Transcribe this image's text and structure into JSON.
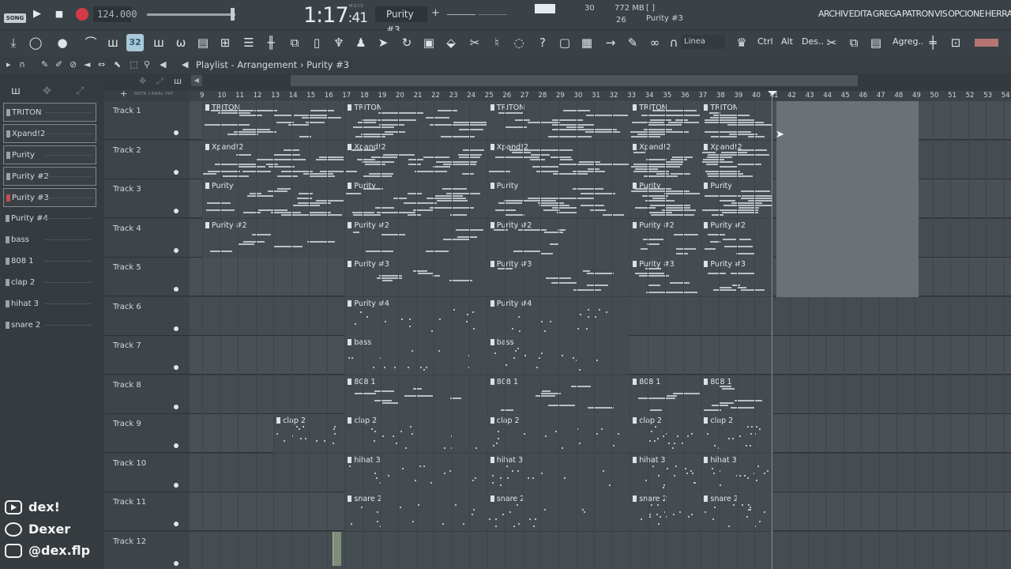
{
  "transport": {
    "song_label": "SONG",
    "tempo": "124.000",
    "time_main": "1:17",
    "time_small": ":41",
    "time_unit": "M:S:CS",
    "pattern": "Purity #3",
    "pattern_plus": "+"
  },
  "stats": {
    "cpu": "30",
    "memory": "772 MB",
    "bracket": "[    ]",
    "polyphony": "26",
    "hint": "Purity #3"
  },
  "menu": [
    "ARCHIV",
    "EDITA",
    "GREGA",
    "PATRON",
    "VIS",
    "OPCIONE",
    "HERRAMIEN"
  ],
  "toolbar": {
    "snap": "Linea",
    "ctrl": "Ctrl",
    "alt": "Alt",
    "des": "Des..",
    "agreg": "Agreg..",
    "active_label": "32"
  },
  "breadcrumb": {
    "view": "Playlist - Arrangement",
    "sep": "›",
    "pattern": "Purity #3"
  },
  "mini_header": "NOTA  CANAL  PAT",
  "patterns": [
    {
      "name": "TRITON",
      "boxed": true,
      "selected": false
    },
    {
      "name": "Xpand!2",
      "boxed": true,
      "selected": false
    },
    {
      "name": "Purity",
      "boxed": true,
      "selected": false
    },
    {
      "name": "Purity #2",
      "boxed": true,
      "selected": false
    },
    {
      "name": "Purity #3",
      "boxed": true,
      "selected": true
    },
    {
      "name": "Purity #4",
      "boxed": false,
      "selected": false
    },
    {
      "name": "bass",
      "boxed": false,
      "selected": false
    },
    {
      "name": "808 1",
      "boxed": false,
      "selected": false
    },
    {
      "name": "clap 2",
      "boxed": false,
      "selected": false
    },
    {
      "name": "hihat 3",
      "boxed": false,
      "selected": false
    },
    {
      "name": "snare 2",
      "boxed": false,
      "selected": false
    }
  ],
  "ruler": [
    "9",
    "10",
    "11",
    "12",
    "13",
    "14",
    "15",
    "16",
    "17",
    "18",
    "19",
    "20",
    "21",
    "22",
    "23",
    "24",
    "25",
    "26",
    "27",
    "28",
    "29",
    "30",
    "31",
    "32",
    "33",
    "34",
    "35",
    "36",
    "37",
    "38",
    "39",
    "40",
    "41",
    "42",
    "43",
    "44",
    "45",
    "46",
    "47",
    "48",
    "49",
    "50",
    "51",
    "52",
    "53",
    "54"
  ],
  "tracks": [
    {
      "name": "Track 1",
      "clips": [
        {
          "bar": 9,
          "label": "TRITON"
        },
        {
          "bar": 17,
          "label": "TRITON"
        },
        {
          "bar": 25,
          "label": "TRITON"
        },
        {
          "bar": 33,
          "label": "TRITON"
        },
        {
          "bar": 37,
          "label": "TRITON"
        }
      ]
    },
    {
      "name": "Track 2",
      "clips": [
        {
          "bar": 9,
          "label": "Xpand!2"
        },
        {
          "bar": 17,
          "label": "Xpand!2"
        },
        {
          "bar": 25,
          "label": "Xpand!2"
        },
        {
          "bar": 33,
          "label": "Xpand!2"
        },
        {
          "bar": 37,
          "label": "Xpand!2"
        }
      ]
    },
    {
      "name": "Track 3",
      "clips": [
        {
          "bar": 9,
          "label": "Purity"
        },
        {
          "bar": 17,
          "label": "Purity"
        },
        {
          "bar": 25,
          "label": "Purity"
        },
        {
          "bar": 33,
          "label": "Purity"
        },
        {
          "bar": 37,
          "label": "Purity"
        }
      ]
    },
    {
      "name": "Track 4",
      "clips": [
        {
          "bar": 9,
          "label": "Purity #2"
        },
        {
          "bar": 17,
          "label": "Purity #2"
        },
        {
          "bar": 25,
          "label": "Purity #2"
        },
        {
          "bar": 33,
          "label": "Purity #2"
        },
        {
          "bar": 37,
          "label": "Purity #2"
        }
      ]
    },
    {
      "name": "Track 5",
      "clips": [
        {
          "bar": 17,
          "label": "Purity #3"
        },
        {
          "bar": 25,
          "label": "Purity #3"
        },
        {
          "bar": 33,
          "label": "Purity #3"
        },
        {
          "bar": 37,
          "label": "Purity #3"
        }
      ]
    },
    {
      "name": "Track 6",
      "clips": [
        {
          "bar": 17,
          "label": "Purity #4"
        },
        {
          "bar": 25,
          "label": "Purity #4"
        }
      ]
    },
    {
      "name": "Track 7",
      "clips": [
        {
          "bar": 17,
          "label": "bass"
        },
        {
          "bar": 25,
          "label": "bass"
        }
      ]
    },
    {
      "name": "Track 8",
      "clips": [
        {
          "bar": 17,
          "label": "808 1"
        },
        {
          "bar": 25,
          "label": "808 1"
        },
        {
          "bar": 33,
          "label": "808 1"
        },
        {
          "bar": 37,
          "label": "808 1"
        }
      ]
    },
    {
      "name": "Track 9",
      "clips": [
        {
          "bar": 13,
          "label": "clap 2"
        },
        {
          "bar": 17,
          "label": "clap 2"
        },
        {
          "bar": 25,
          "label": "clap 2"
        },
        {
          "bar": 33,
          "label": "clap 2"
        },
        {
          "bar": 37,
          "label": "clap 2"
        }
      ]
    },
    {
      "name": "Track 10",
      "clips": [
        {
          "bar": 17,
          "label": "hihat 3"
        },
        {
          "bar": 25,
          "label": "hihat 3"
        },
        {
          "bar": 33,
          "label": "hihat 3"
        },
        {
          "bar": 37,
          "label": "hihat 3"
        }
      ]
    },
    {
      "name": "Track 11",
      "clips": [
        {
          "bar": 17,
          "label": "snare 2"
        },
        {
          "bar": 25,
          "label": "snare 2"
        },
        {
          "bar": 33,
          "label": "snare 2"
        },
        {
          "bar": 37,
          "label": "snare 2"
        }
      ]
    },
    {
      "name": "Track 12",
      "clips": []
    }
  ],
  "playhead_bar": 41,
  "social": [
    {
      "icon": "youtube-icon",
      "text": "dex!"
    },
    {
      "icon": "spotify-icon",
      "text": "Dexer"
    },
    {
      "icon": "instagram-icon",
      "text": "@dex.flp"
    }
  ],
  "colors": {
    "record": "#d23b46",
    "selected_pattern": "#c84b55",
    "active_tool": "#a9c8d8"
  }
}
